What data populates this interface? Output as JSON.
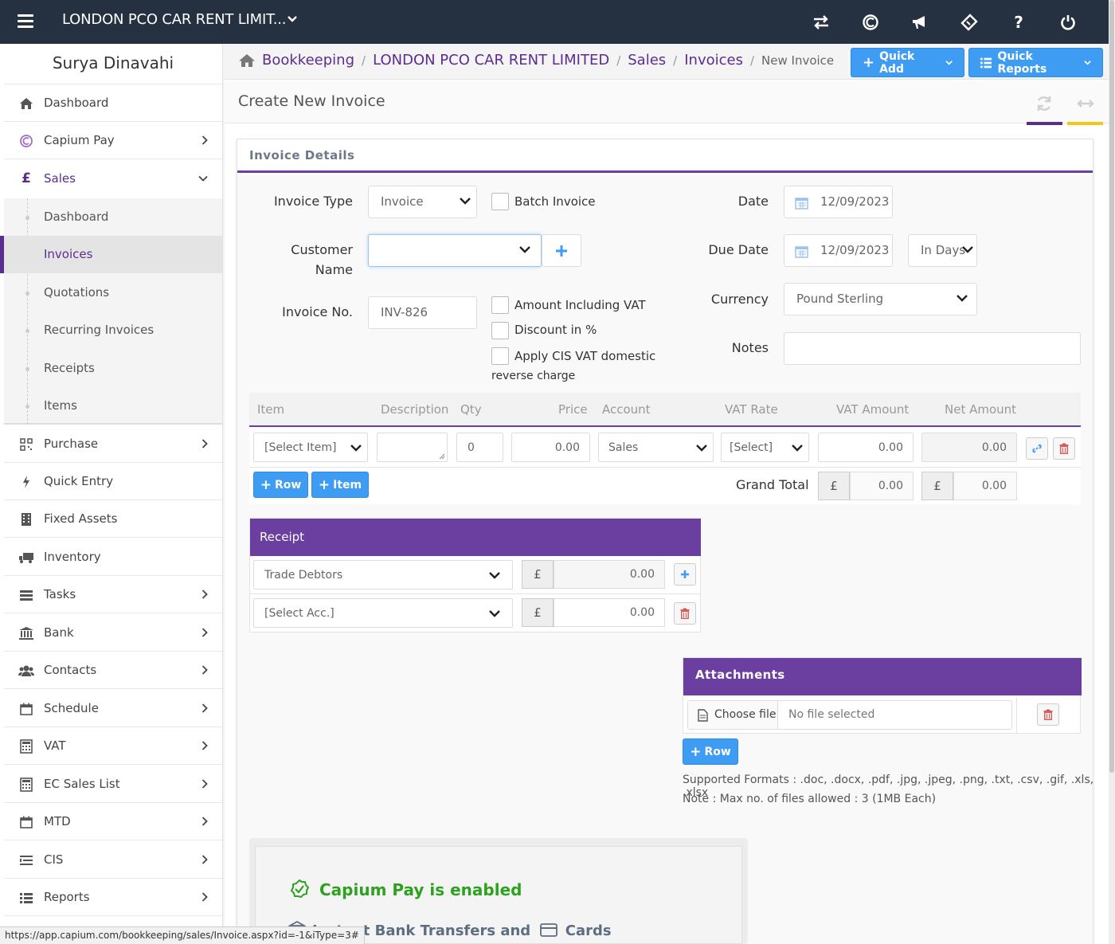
{
  "topbar": {
    "company": "LONDON PCO CAR RENT LIMIT...",
    "icons": [
      "switch-icon",
      "capium-icon",
      "megaphone-icon",
      "ticket-icon",
      "help-icon",
      "power-icon"
    ],
    "help_glyph": "?"
  },
  "sidebar": {
    "user": "Surya Dinavahi",
    "items": [
      {
        "label": "Dashboard",
        "icon": "home-icon"
      },
      {
        "label": "Capium Pay",
        "icon": "capium-pay-icon"
      },
      {
        "label": "Sales",
        "icon": "pound-icon"
      },
      {
        "label": "Purchase",
        "icon": "qr-icon"
      },
      {
        "label": "Quick Entry",
        "icon": "bolt-icon"
      },
      {
        "label": "Fixed Assets",
        "icon": "building-icon"
      },
      {
        "label": "Inventory",
        "icon": "truck-icon"
      },
      {
        "label": "Tasks",
        "icon": "tasks-icon"
      },
      {
        "label": "Bank",
        "icon": "bank-icon"
      },
      {
        "label": "Contacts",
        "icon": "users-icon"
      },
      {
        "label": "Schedule",
        "icon": "calendar-icon"
      },
      {
        "label": "VAT",
        "icon": "calculator-icon"
      },
      {
        "label": "EC Sales List",
        "icon": "calculator-icon"
      },
      {
        "label": "MTD",
        "icon": "calendar-icon"
      },
      {
        "label": "CIS",
        "icon": "list-icon"
      },
      {
        "label": "Reports",
        "icon": "list-icon"
      }
    ],
    "sales_sub": [
      "Dashboard",
      "Invoices",
      "Quotations",
      "Recurring Invoices",
      "Receipts",
      "Items"
    ],
    "pound_glyph": "£"
  },
  "breadcrumb": {
    "items": [
      "Bookkeeping",
      "LONDON PCO CAR RENT LIMITED",
      "Sales",
      "Invoices"
    ],
    "current": "New Invoice",
    "separator": "/"
  },
  "actions": {
    "quick_add": "Quick Add",
    "quick_reports": "Quick Reports"
  },
  "page": {
    "title": "Create New Invoice",
    "accent_purple": "#5b2d90",
    "accent_yellow": "#f5c518"
  },
  "invoice": {
    "panel_title": "Invoice Details",
    "invoice_type_label": "Invoice Type",
    "invoice_type_value": "Invoice",
    "batch_invoice_label": "Batch Invoice",
    "customer_label_1": "Customer",
    "customer_label_2": "Name",
    "customer_value": "",
    "invoice_no_label": "Invoice No.",
    "invoice_no_value": "INV-826",
    "amount_incl_vat": "Amount Including VAT",
    "discount_pct": "Discount in %",
    "cis_line1": "Apply CIS VAT domestic",
    "cis_line2": "reverse charge",
    "date_label": "Date",
    "date_value": "12/09/2023",
    "due_date_label": "Due Date",
    "due_date_value": "12/09/2023",
    "due_mode": "In Days",
    "currency_label": "Currency",
    "currency_value": "Pound Sterling",
    "notes_label": "Notes",
    "notes_value": ""
  },
  "items_table": {
    "columns": [
      "Item",
      "Description",
      "Qty",
      "Price",
      "Account",
      "VAT Rate",
      "VAT Amount",
      "Net Amount"
    ],
    "row": {
      "item": "[Select Item]",
      "description": "",
      "qty": "0",
      "price": "0.00",
      "account": "Sales",
      "vat_rate": "[Select]",
      "vat_amount": "0.00",
      "net_amount": "0.00"
    },
    "add_row": "Row",
    "add_item": "Item",
    "grand_total_label": "Grand Total",
    "currency_symbol": "£",
    "grand_total_vat": "0.00",
    "grand_total_net": "0.00"
  },
  "receipt": {
    "title": "Receipt",
    "rows": [
      {
        "account": "Trade Debtors",
        "symbol": "£",
        "amount": "0.00"
      },
      {
        "account": "[Select Acc.]",
        "symbol": "£",
        "amount": "0.00"
      }
    ]
  },
  "attachments": {
    "title": "Attachments",
    "choose_file": "Choose file",
    "no_file": "No file selected",
    "add_row": "Row",
    "formats": "Supported Formats : .doc, .docx, .pdf, .jpg, .jpeg, .png, .txt, .csv, .gif, .xls, .xlsx",
    "note": "Note : Max no. of files allowed : 3 (1MB Each)"
  },
  "capium_pay": {
    "enabled": "Capium Pay is enabled",
    "methods": "Instant Bank Transfers and",
    "cards": "Cards"
  },
  "status_url": "https://app.capium.com/bookkeeping/sales/Invoice.aspx?id=-1&iType=3#"
}
